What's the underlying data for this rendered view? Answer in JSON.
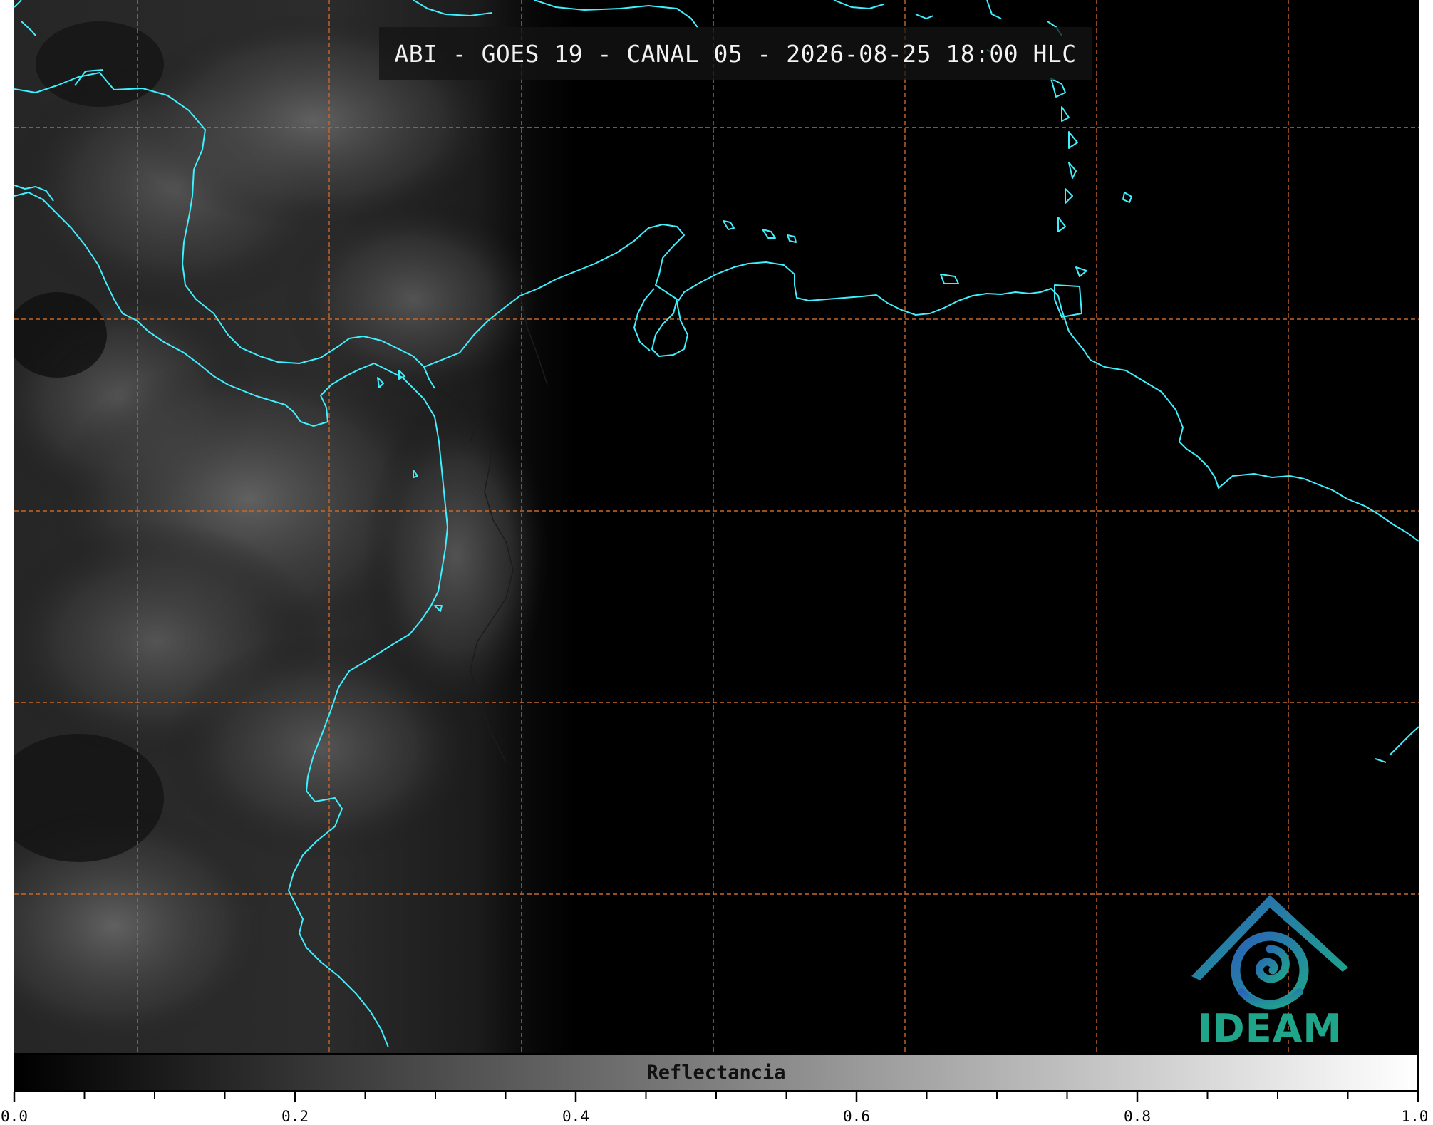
{
  "title": "ABI - GOES 19 - CANAL 05 - 2026-08-25 18:00 HLC",
  "logo": {
    "text": "IDEAM",
    "icon": "ideam-swirl-roof-icon",
    "color": "#1fa58a"
  },
  "colorbar": {
    "label": "Reflectancia",
    "range": [
      0.0,
      1.0
    ],
    "colormap": "grayscale",
    "major_ticks": [
      "0.0",
      "0.2",
      "0.4",
      "0.6",
      "0.8",
      "1.0"
    ],
    "minor_tick_step": 0.05
  },
  "map": {
    "coastline_color": "#3ff0ff",
    "grid_color": "#c8672a",
    "grid_style": "dashed",
    "background": "#000000"
  }
}
